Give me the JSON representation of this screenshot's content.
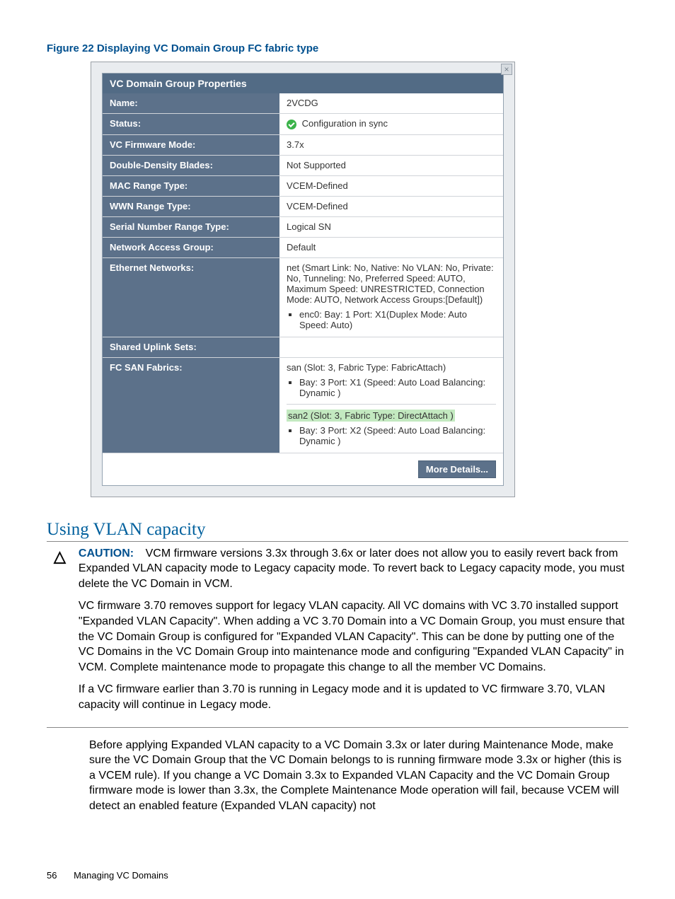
{
  "figure_caption": "Figure 22 Displaying VC Domain Group FC fabric type",
  "panel": {
    "close_label": "×",
    "title": "VC Domain Group Properties",
    "rows": {
      "name_label": "Name:",
      "name_val": "2VCDG",
      "status_label": "Status:",
      "status_val": "Configuration in sync",
      "fw_label": "VC Firmware Mode:",
      "fw_val": "3.7x",
      "dd_label": "Double-Density Blades:",
      "dd_val": "Not Supported",
      "mac_label": "MAC Range Type:",
      "mac_val": "VCEM-Defined",
      "wwn_label": "WWN Range Type:",
      "wwn_val": "VCEM-Defined",
      "sn_label": "Serial Number Range Type:",
      "sn_val": "Logical SN",
      "nag_label": "Network Access Group:",
      "nag_val": "Default",
      "eth_label": "Ethernet Networks:",
      "eth_val_main": "net (Smart Link: No, Native: No VLAN: No, Private: No, Tunneling: No, Preferred Speed: AUTO, Maximum Speed: UNRESTRICTED, Connection Mode: AUTO, Network Access Groups:[Default])",
      "eth_val_item": "enc0: Bay: 1 Port: X1(Duplex Mode: Auto Speed: Auto)",
      "sus_label": "Shared Uplink Sets:",
      "fc_label": "FC SAN Fabrics:",
      "fc_san_main": "san (Slot: 3, Fabric Type: FabricAttach)",
      "fc_san_item": "Bay: 3 Port: X1 (Speed: Auto Load Balancing: Dynamic )",
      "fc_san2_main": "san2 (Slot: 3, Fabric Type: DirectAttach )",
      "fc_san2_item": "Bay: 3 Port: X2 (Speed: Auto Load Balancing: Dynamic )"
    },
    "more_button": "More Details..."
  },
  "section_heading": "Using VLAN capacity",
  "caution": {
    "label": "CAUTION:",
    "p1": "VCM firmware versions 3.3x through 3.6x or later does not allow you to easily revert back from Expanded VLAN capacity mode to Legacy capacity mode. To revert back to Legacy capacity mode, you must delete the VC Domain in VCM.",
    "p2": "VC firmware 3.70 removes support for legacy VLAN capacity. All VC domains with VC 3.70 installed support \"Expanded VLAN Capacity\". When adding a VC 3.70 Domain into a VC Domain Group, you must ensure that the VC Domain Group is configured for \"Expanded VLAN Capacity\". This can be done by putting one of the VC Domains in the VC Domain Group into maintenance mode and configuring \"Expanded VLAN Capacity\" in VCM. Complete maintenance mode to propagate this change to all the member VC Domains.",
    "p3": "If a VC firmware earlier than 3.70 is running in Legacy mode and it is updated to VC firmware 3.70, VLAN capacity will continue in Legacy mode."
  },
  "body_para": "Before applying Expanded VLAN capacity to a VC Domain 3.3x or later during Maintenance Mode, make sure the VC Domain Group that the VC Domain belongs to is running firmware mode 3.3x or higher (this is a VCEM rule). If you change a VC Domain 3.3x to Expanded VLAN Capacity and the VC Domain Group firmware mode is lower than 3.3x, the Complete Maintenance Mode operation will fail, because VCEM will detect an enabled feature (Expanded VLAN capacity) not",
  "footer": {
    "page": "56",
    "section": "Managing VC Domains"
  }
}
